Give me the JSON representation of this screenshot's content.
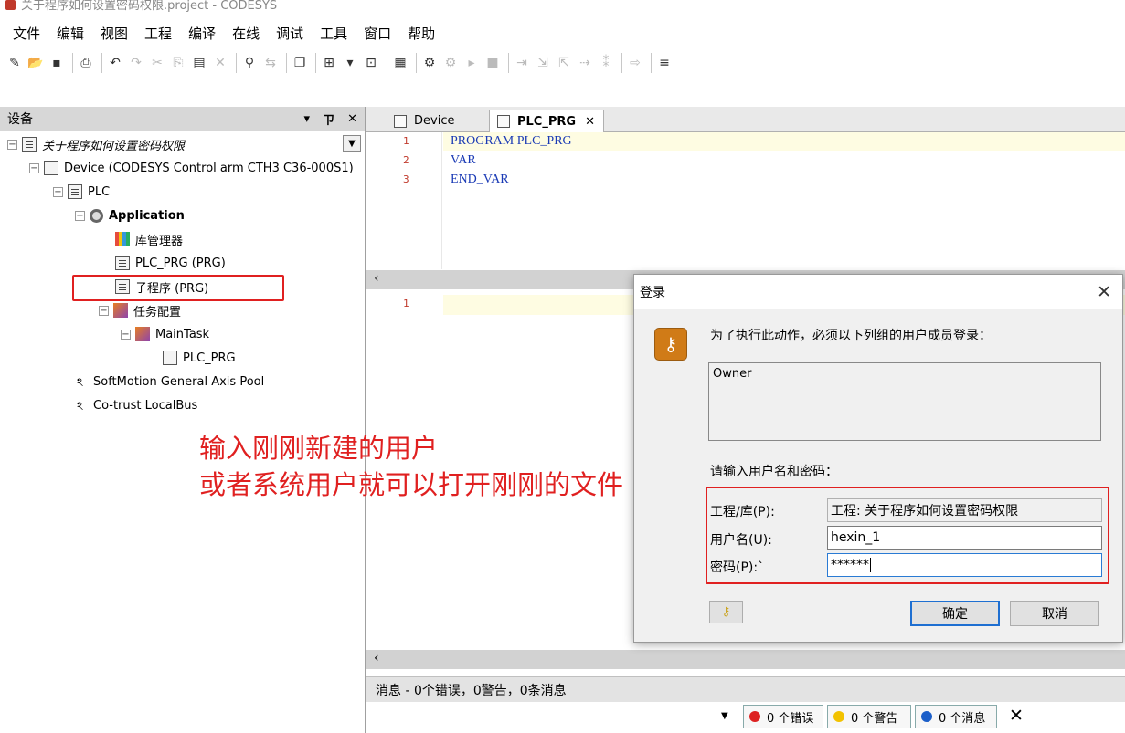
{
  "window": {
    "title": "关于程序如何设置密码权限.project - CODESYS"
  },
  "menu": [
    "文件",
    "编辑",
    "视图",
    "工程",
    "编译",
    "在线",
    "调试",
    "工具",
    "窗口",
    "帮助"
  ],
  "device_panel": {
    "title": "设备",
    "pin_glyph": "ㄗ",
    "close_glyph": "✕",
    "dropdown_glyph": "▾",
    "tree": {
      "root": "关于程序如何设置密码权限",
      "device": "Device (CODESYS Control arm CTH3 C36-000S1)",
      "plc": "PLC",
      "application": "Application",
      "library_manager": "库管理器",
      "plc_prg": "PLC_PRG (PRG)",
      "subprogram": "子程序 (PRG)",
      "task_config": "任务配置",
      "main_task": "MainTask",
      "main_task_prg": "PLC_PRG",
      "softmotion": "SoftMotion General Axis Pool",
      "localbus": "Co-trust LocalBus"
    }
  },
  "editor": {
    "tabs": [
      {
        "label": "Device"
      },
      {
        "label": "PLC_PRG"
      }
    ],
    "declaration_lines": [
      {
        "num": "1",
        "text": "PROGRAM PLC_PRG"
      },
      {
        "num": "2",
        "text": "VAR"
      },
      {
        "num": "3",
        "text": "END_VAR"
      }
    ],
    "body_lines": [
      {
        "num": "1",
        "text": ""
      }
    ]
  },
  "messages": {
    "header": "消息 - 0个错误，0警告，0条消息",
    "errors": "0 个错误",
    "warnings": "0 个警告",
    "infos": "0 个消息"
  },
  "annotation": {
    "line1": "输入刚刚新建的用户",
    "line2": "或者系统用户就可以打开刚刚的文件"
  },
  "login_dialog": {
    "title": "登录",
    "message": "为了执行此动作，必须以下列组的用户成员登录：",
    "groups": [
      "Owner"
    ],
    "prompt": "请输入用户名和密码：",
    "project_label": "工程/库(P):",
    "project_value": "工程: 关于程序如何设置密码权限",
    "user_label": "用户名(U):",
    "user_value": "hexin_1",
    "password_label": "密码(P):`",
    "password_value": "******",
    "ok_label": "确定",
    "cancel_label": "取消"
  },
  "colors": {
    "accent_red": "#e02020",
    "keyword_blue": "#1a3ab5",
    "line_number_red": "#c0392b",
    "key_icon_orange": "#d07b17"
  }
}
